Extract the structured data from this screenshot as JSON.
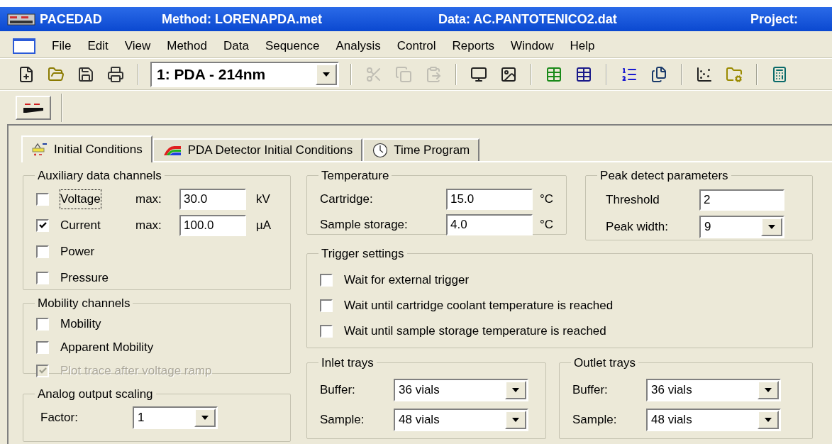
{
  "window": {
    "title": "PACEDAD",
    "method": "Method: LORENAPDA.met",
    "data": "Data: AC.PANTOTENICO2.dat",
    "project": "Project:"
  },
  "menu": [
    "File",
    "Edit",
    "View",
    "Method",
    "Data",
    "Sequence",
    "Analysis",
    "Control",
    "Reports",
    "Window",
    "Help"
  ],
  "toolbar": {
    "buttons": [
      {
        "kind": "new",
        "disabled": false
      },
      {
        "kind": "open",
        "disabled": false
      },
      {
        "kind": "save",
        "disabled": false
      },
      {
        "kind": "print",
        "disabled": false
      },
      {
        "kind": "channel"
      },
      {
        "kind": "cut",
        "disabled": true
      },
      {
        "kind": "copy",
        "disabled": true
      },
      {
        "kind": "paste",
        "disabled": true
      },
      {
        "kind": "monitor",
        "disabled": false
      },
      {
        "kind": "picture",
        "disabled": false
      },
      {
        "kind": "table",
        "disabled": false
      },
      {
        "kind": "table2",
        "disabled": false
      },
      {
        "kind": "list",
        "disabled": false
      },
      {
        "kind": "files",
        "disabled": false
      },
      {
        "kind": "scatter",
        "disabled": false
      },
      {
        "kind": "folder-config",
        "disabled": false
      },
      {
        "kind": "calculator",
        "disabled": false
      }
    ],
    "channel_select": {
      "value": "1: PDA - 214nm"
    }
  },
  "tabs": [
    {
      "label": "Initial Conditions",
      "selected": true,
      "kind": "initial"
    },
    {
      "label": "PDA Detector Initial Conditions",
      "selected": false,
      "kind": "pda"
    },
    {
      "label": "Time Program",
      "selected": false,
      "kind": "time"
    }
  ],
  "auxiliary": {
    "title": "Auxiliary data channels",
    "items": [
      {
        "label": "Voltage",
        "checked": false,
        "focused": true,
        "max_label": "max:",
        "value": "30.0",
        "unit": "kV"
      },
      {
        "label": "Current",
        "checked": true,
        "focused": false,
        "max_label": "max:",
        "value": "100.0",
        "unit": "µA"
      },
      {
        "label": "Power",
        "checked": false,
        "focused": false
      },
      {
        "label": "Pressure",
        "checked": false,
        "focused": false
      }
    ]
  },
  "mobility": {
    "title": "Mobility channels",
    "items": [
      {
        "label": "Mobility",
        "checked": false,
        "disabled": false
      },
      {
        "label": "Apparent Mobility",
        "checked": false,
        "disabled": false
      },
      {
        "label": "Plot trace after voltage ramp",
        "checked": true,
        "disabled": true
      }
    ]
  },
  "analog": {
    "title": "Analog output scaling",
    "label": "Factor:",
    "value": "1"
  },
  "temperature": {
    "title": "Temperature",
    "rows": [
      {
        "label": "Cartridge:",
        "value": "15.0",
        "unit": "°C"
      },
      {
        "label": "Sample storage:",
        "value": "4.0",
        "unit": "°C"
      }
    ]
  },
  "peak": {
    "title": "Peak detect parameters",
    "rows": [
      {
        "label": "Threshold",
        "value": "2",
        "kind": "text"
      },
      {
        "label": "Peak width:",
        "value": "9",
        "kind": "dropdown"
      }
    ]
  },
  "trigger": {
    "title": "Trigger settings",
    "items": [
      {
        "label": "Wait for external trigger",
        "checked": false
      },
      {
        "label": "Wait until cartridge coolant temperature is reached",
        "checked": false
      },
      {
        "label": "Wait until sample storage temperature is reached",
        "checked": false
      }
    ]
  },
  "inlet": {
    "title": "Inlet trays",
    "rows": [
      {
        "label": "Buffer:",
        "value": "36 vials"
      },
      {
        "label": "Sample:",
        "value": "48 vials"
      }
    ]
  },
  "outlet": {
    "title": "Outlet trays",
    "rows": [
      {
        "label": "Buffer:",
        "value": "36 vials"
      },
      {
        "label": "Sample:",
        "value": "48 vials"
      }
    ]
  }
}
